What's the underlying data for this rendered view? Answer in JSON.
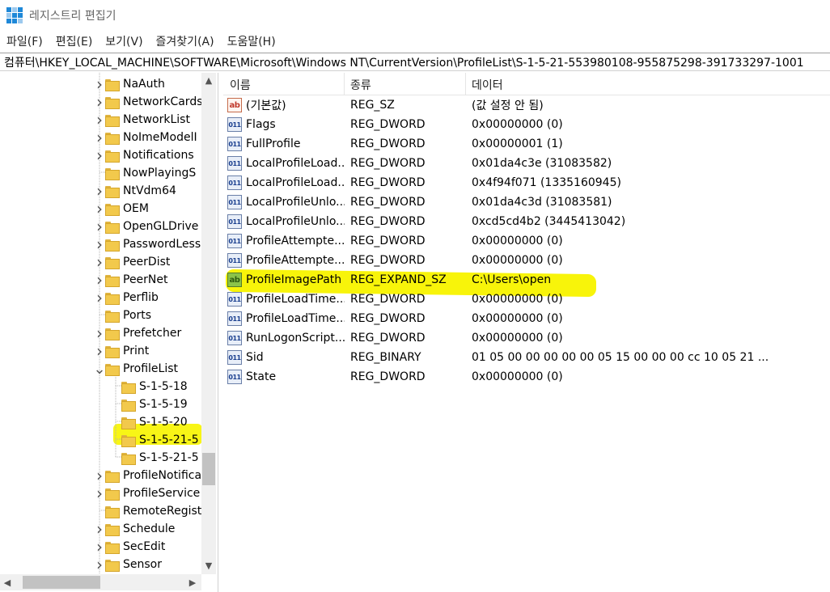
{
  "window": {
    "title": "레지스트리 편집기"
  },
  "menu": [
    "파일(F)",
    "편집(E)",
    "보기(V)",
    "즐겨찾기(A)",
    "도움말(H)"
  ],
  "address": "컴퓨터\\HKEY_LOCAL_MACHINE\\SOFTWARE\\Microsoft\\Windows NT\\CurrentVersion\\ProfileList\\S-1-5-21-553980108-955875298-391733297-1001",
  "tree": [
    {
      "label": "NaAuth",
      "level": 0,
      "expander": ">"
    },
    {
      "label": "NetworkCards",
      "level": 0,
      "expander": ">"
    },
    {
      "label": "NetworkList",
      "level": 0,
      "expander": ">"
    },
    {
      "label": "NoImeModelI",
      "level": 0,
      "expander": ">"
    },
    {
      "label": "Notifications",
      "level": 0,
      "expander": ">"
    },
    {
      "label": "NowPlayingS",
      "level": 0,
      "expander": ""
    },
    {
      "label": "NtVdm64",
      "level": 0,
      "expander": ">"
    },
    {
      "label": "OEM",
      "level": 0,
      "expander": ">"
    },
    {
      "label": "OpenGLDrive",
      "level": 0,
      "expander": ">"
    },
    {
      "label": "PasswordLess",
      "level": 0,
      "expander": ">"
    },
    {
      "label": "PeerDist",
      "level": 0,
      "expander": ">"
    },
    {
      "label": "PeerNet",
      "level": 0,
      "expander": ">"
    },
    {
      "label": "Perflib",
      "level": 0,
      "expander": ">"
    },
    {
      "label": "Ports",
      "level": 0,
      "expander": ""
    },
    {
      "label": "Prefetcher",
      "level": 0,
      "expander": ">"
    },
    {
      "label": "Print",
      "level": 0,
      "expander": ">"
    },
    {
      "label": "ProfileList",
      "level": 0,
      "expander": "v"
    },
    {
      "label": "S-1-5-18",
      "level": 1,
      "expander": ""
    },
    {
      "label": "S-1-5-19",
      "level": 1,
      "expander": ""
    },
    {
      "label": "S-1-5-20",
      "level": 1,
      "expander": ""
    },
    {
      "label": "S-1-5-21-5",
      "level": 1,
      "expander": "",
      "highlighted": true
    },
    {
      "label": "S-1-5-21-5",
      "level": 1,
      "expander": ""
    },
    {
      "label": "ProfileNotifica",
      "level": 0,
      "expander": ">"
    },
    {
      "label": "ProfileService",
      "level": 0,
      "expander": ">"
    },
    {
      "label": "RemoteRegist",
      "level": 0,
      "expander": ""
    },
    {
      "label": "Schedule",
      "level": 0,
      "expander": ">"
    },
    {
      "label": "SecEdit",
      "level": 0,
      "expander": ">"
    },
    {
      "label": "Sensor",
      "level": 0,
      "expander": ">"
    }
  ],
  "columns": {
    "name": "이름",
    "type": "종류",
    "data": "데이터"
  },
  "values": [
    {
      "icon": "string-value-icon",
      "badge": "ab",
      "kind": "str",
      "name": "(기본값)",
      "type": "REG_SZ",
      "data": "(값 설정 안 됨)"
    },
    {
      "icon": "binary-value-icon",
      "badge": "011",
      "kind": "bin",
      "name": "Flags",
      "type": "REG_DWORD",
      "data": "0x00000000 (0)"
    },
    {
      "icon": "binary-value-icon",
      "badge": "011",
      "kind": "bin",
      "name": "FullProfile",
      "type": "REG_DWORD",
      "data": "0x00000001 (1)"
    },
    {
      "icon": "binary-value-icon",
      "badge": "011",
      "kind": "bin",
      "name": "LocalProfileLoad...",
      "type": "REG_DWORD",
      "data": "0x01da4c3e (31083582)"
    },
    {
      "icon": "binary-value-icon",
      "badge": "011",
      "kind": "bin",
      "name": "LocalProfileLoad...",
      "type": "REG_DWORD",
      "data": "0x4f94f071 (1335160945)"
    },
    {
      "icon": "binary-value-icon",
      "badge": "011",
      "kind": "bin",
      "name": "LocalProfileUnlo...",
      "type": "REG_DWORD",
      "data": "0x01da4c3d (31083581)"
    },
    {
      "icon": "binary-value-icon",
      "badge": "011",
      "kind": "bin",
      "name": "LocalProfileUnlo...",
      "type": "REG_DWORD",
      "data": "0xcd5cd4b2 (3445413042)"
    },
    {
      "icon": "binary-value-icon",
      "badge": "011",
      "kind": "bin",
      "name": "ProfileAttempte...",
      "type": "REG_DWORD",
      "data": "0x00000000 (0)"
    },
    {
      "icon": "binary-value-icon",
      "badge": "011",
      "kind": "bin",
      "name": "ProfileAttempte...",
      "type": "REG_DWORD",
      "data": "0x00000000 (0)"
    },
    {
      "icon": "expand-string-value-icon",
      "badge": "ab",
      "kind": "expstr",
      "name": "ProfileImagePath",
      "type": "REG_EXPAND_SZ",
      "data": "C:\\Users\\open"
    },
    {
      "icon": "binary-value-icon",
      "badge": "011",
      "kind": "bin",
      "name": "ProfileLoadTime...",
      "type": "REG_DWORD",
      "data": "0x00000000 (0)"
    },
    {
      "icon": "binary-value-icon",
      "badge": "011",
      "kind": "bin",
      "name": "ProfileLoadTime...",
      "type": "REG_DWORD",
      "data": "0x00000000 (0)"
    },
    {
      "icon": "binary-value-icon",
      "badge": "011",
      "kind": "bin",
      "name": "RunLogonScript...",
      "type": "REG_DWORD",
      "data": "0x00000000 (0)"
    },
    {
      "icon": "binary-value-icon",
      "badge": "011",
      "kind": "bin",
      "name": "Sid",
      "type": "REG_BINARY",
      "data": "01 05 00 00 00 00 00 05 15 00 00 00 cc 10 05 21 ..."
    },
    {
      "icon": "binary-value-icon",
      "badge": "011",
      "kind": "bin",
      "name": "State",
      "type": "REG_DWORD",
      "data": "0x00000000 (0)"
    }
  ],
  "colors": {
    "highlight": "#f8f40a",
    "folder": "#f2c94c",
    "scrollbar": "#f0f0f0"
  }
}
